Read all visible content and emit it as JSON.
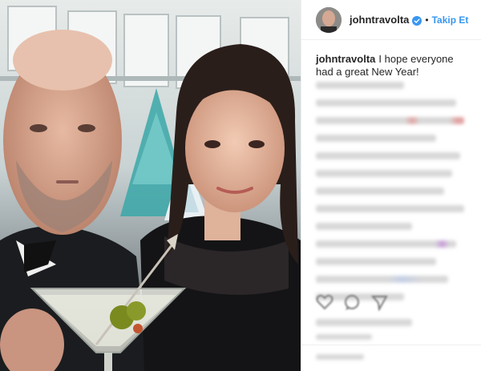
{
  "post": {
    "image_description_icon": "photo-of-two-people-holding-martini",
    "header": {
      "username": "johntravolta",
      "verified_icon": "verified-badge-icon",
      "separator": "•",
      "follow_label": "Takip Et",
      "follow_color": "#3897f0"
    },
    "caption": {
      "username": "johntravolta",
      "text": "I hope everyone had a great New Year!"
    }
  }
}
